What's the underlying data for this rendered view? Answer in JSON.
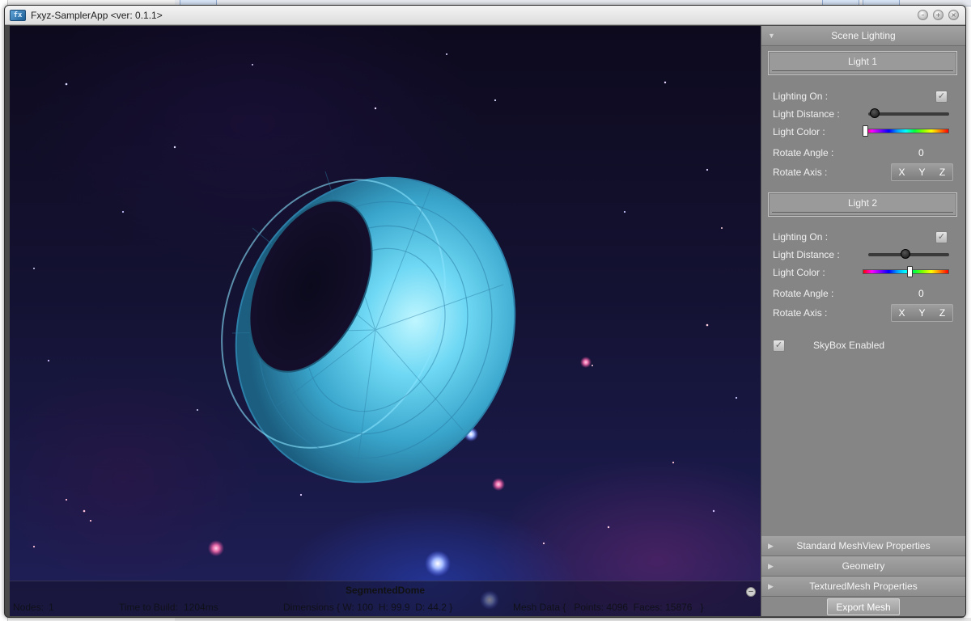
{
  "window": {
    "title": "Fxyz-SamplerApp <ver: 0.1.1>",
    "icon": "fxyz-app-icon",
    "controls": [
      "minimize",
      "maximize",
      "close"
    ]
  },
  "viewport": {
    "skybox": "space nebula",
    "mesh_color": "#5fc8ea"
  },
  "info_bar": {
    "title": "SegmentedDome",
    "nodes_label": "Nodes:",
    "nodes_value": "1",
    "build_label": "Time to Build:",
    "build_value": "1204ms",
    "dimensions": "Dimensions { W: 100  H: 99.9  D: 44.2 }",
    "mesh_data": "Mesh Data {   Points: 4096  Faces: 15876   }"
  },
  "panel": {
    "scene_lighting": "Scene Lighting",
    "light1": {
      "header": "Light 1",
      "lighting_on_label": "Lighting On :",
      "lighting_on": true,
      "distance_label": "Light Distance :",
      "distance_fraction": 0.02,
      "color_label": "Light Color :",
      "color_fraction": 0.0,
      "angle_label": "Rotate Angle :",
      "angle_value": "0",
      "axis_label": "Rotate Axis :",
      "axes": [
        "X",
        "Y",
        "Z"
      ]
    },
    "light2": {
      "header": "Light 2",
      "lighting_on_label": "Lighting On :",
      "lighting_on": true,
      "distance_label": "Light Distance :",
      "distance_fraction": 0.45,
      "color_label": "Light Color :",
      "color_fraction": 0.55,
      "angle_label": "Rotate Angle :",
      "angle_value": "0",
      "axis_label": "Rotate Axis :",
      "axes": [
        "X",
        "Y",
        "Z"
      ]
    },
    "skybox_label": "SkyBox Enabled",
    "skybox_enabled": true,
    "sections": [
      "Standard MeshView Properties",
      "Geometry",
      "TexturedMesh Properties"
    ],
    "export_label": "Export Mesh"
  }
}
